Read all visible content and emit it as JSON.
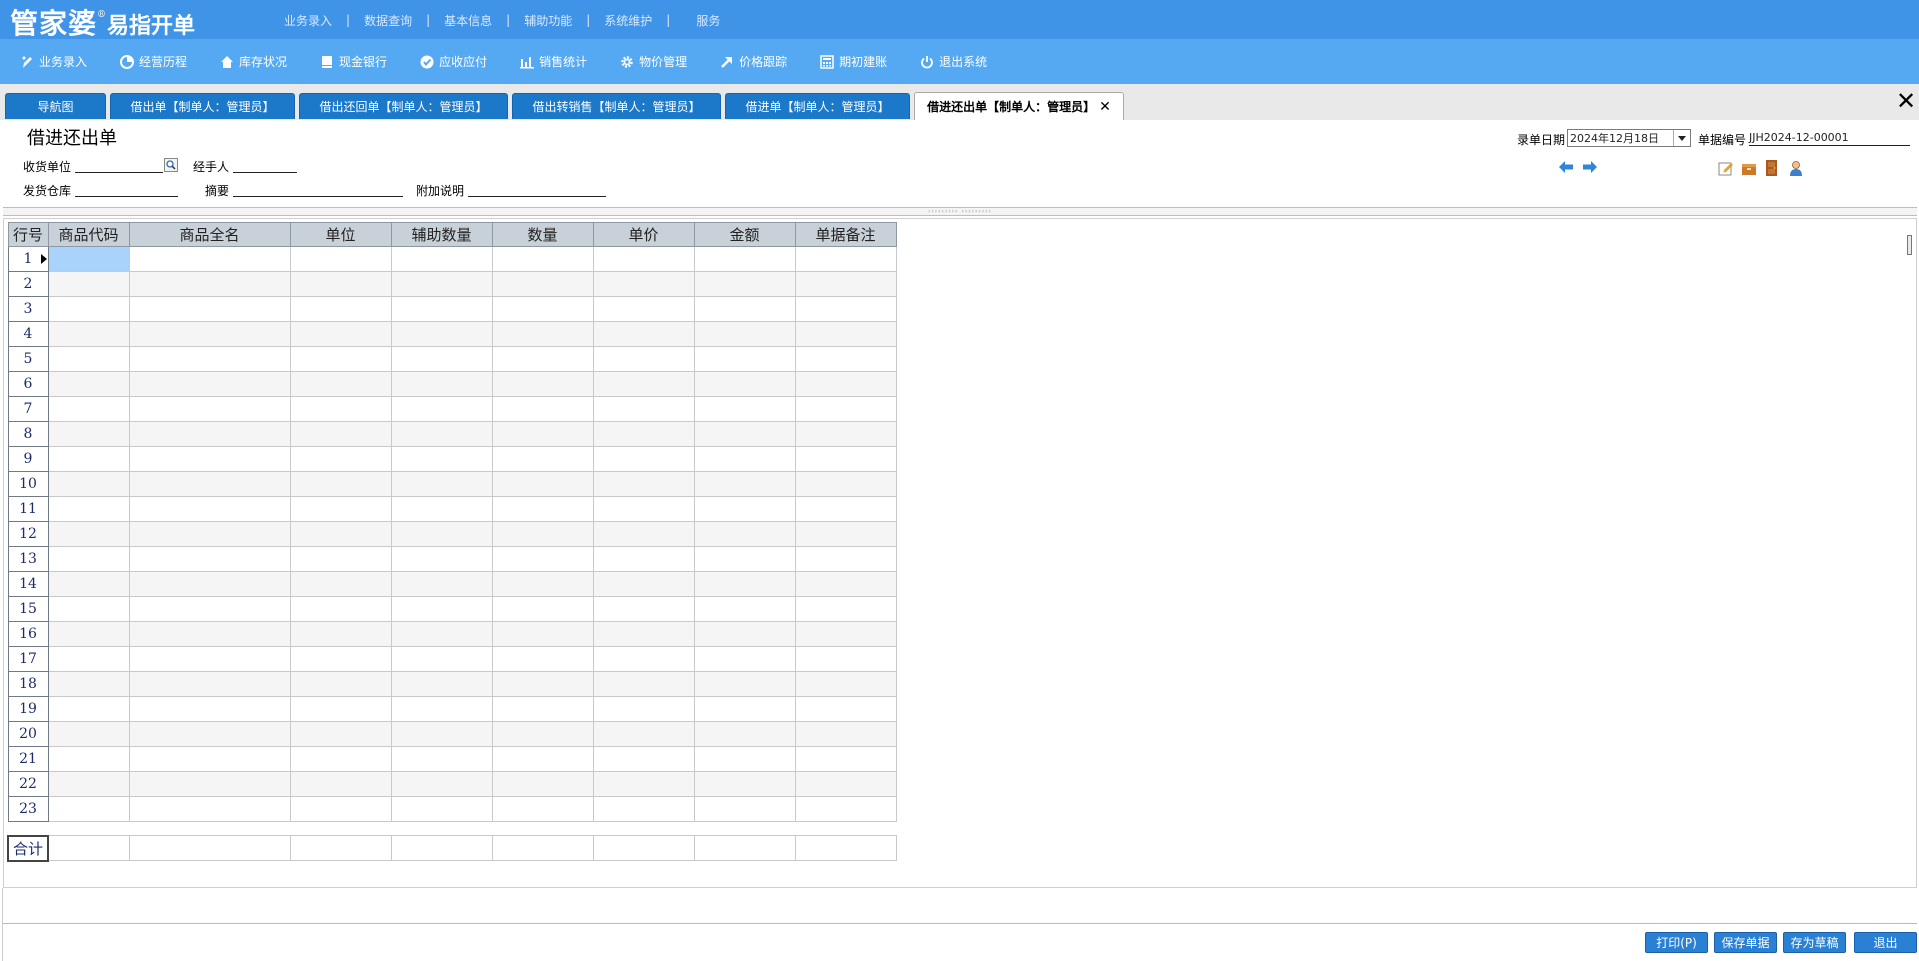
{
  "app": {
    "brand": "管家婆",
    "reg": "®",
    "product": "易指开单"
  },
  "top_menu": [
    "业务录入",
    "数据查询",
    "基本信息",
    "辅助功能",
    "系统维护",
    "服务"
  ],
  "toolbar": [
    {
      "label": "业务录入",
      "icon": "pen-icon"
    },
    {
      "label": "经营历程",
      "icon": "pie-chart-icon"
    },
    {
      "label": "库存状况",
      "icon": "warehouse-icon"
    },
    {
      "label": "现金银行",
      "icon": "book-icon"
    },
    {
      "label": "应收应付",
      "icon": "check-circle-icon"
    },
    {
      "label": "销售统计",
      "icon": "bar-chart-icon"
    },
    {
      "label": "物价管理",
      "icon": "gear-icon"
    },
    {
      "label": "价格跟踪",
      "icon": "arrow-up-right-icon"
    },
    {
      "label": "期初建账",
      "icon": "calculator-icon"
    },
    {
      "label": "退出系统",
      "icon": "power-icon"
    }
  ],
  "tabs": [
    {
      "label": "导航图",
      "active": false
    },
    {
      "label": "借出单【制单人：管理员】",
      "active": false
    },
    {
      "label": "借出还回单【制单人：管理员】",
      "active": false
    },
    {
      "label": "借出转销售【制单人：管理员】",
      "active": false
    },
    {
      "label": "借进单【制单人：管理员】",
      "active": false
    },
    {
      "label": "借进还出单【制单人：管理员】",
      "active": true
    }
  ],
  "tab_close_glyph": "✕",
  "close_all_glyph": "✕",
  "form": {
    "title": "借进还出单",
    "receiver_label": "收货单位",
    "handler_label": "经手人",
    "warehouse_label": "发货仓库",
    "summary_label": "摘要",
    "extra_label": "附加说明",
    "date_label": "录单日期",
    "date_value": "2024年12月18日",
    "docno_label": "单据编号",
    "docno_value": "JJH2024-12-00001"
  },
  "splitter_text": "››››››››› ›››››››››",
  "grid": {
    "columns": [
      "行号",
      "商品代码",
      "商品全名",
      "单位",
      "辅助数量",
      "数量",
      "单价",
      "金额",
      "单据备注"
    ],
    "row_count": 23,
    "selected_row": 1,
    "total_label": "合计"
  },
  "footer_buttons": [
    "打印(P)",
    "保存单据",
    "存为草稿",
    "退出"
  ],
  "colors": {
    "top_bar": "#3f94e8",
    "toolbar": "#55a9f3",
    "tab": "#1c78c9",
    "header_bg": "#c8d0d8",
    "selected_cell": "#a9d3fb",
    "button": "#2a80d3"
  }
}
